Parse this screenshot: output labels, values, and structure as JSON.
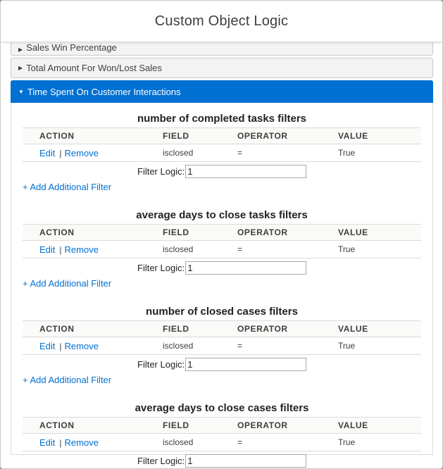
{
  "modal": {
    "title": "Custom Object Logic"
  },
  "sections": [
    {
      "label": "Sales Win Percentage",
      "expanded": false
    },
    {
      "label": "Total Amount For Won/Lost Sales",
      "expanded": false
    },
    {
      "label": "Time Spent On Customer Interactions",
      "expanded": true
    }
  ],
  "columns": [
    "ACTION",
    "FIELD",
    "OPERATOR",
    "VALUE"
  ],
  "actions": {
    "edit": "Edit",
    "separator": "|",
    "remove": "Remove"
  },
  "filter_logic_label": "Filter Logic:",
  "add_filter_label": "+ Add Additional Filter",
  "filters": [
    {
      "title": "number of completed tasks filters",
      "rows": [
        {
          "field": "isclosed",
          "operator": "=",
          "value": "True"
        }
      ],
      "logic": "1"
    },
    {
      "title": "average days to close tasks filters",
      "rows": [
        {
          "field": "isclosed",
          "operator": "=",
          "value": "True"
        }
      ],
      "logic": "1"
    },
    {
      "title": "number of closed cases filters",
      "rows": [
        {
          "field": "isclosed",
          "operator": "=",
          "value": "True"
        }
      ],
      "logic": "1"
    },
    {
      "title": "average days to close cases filters",
      "rows": [
        {
          "field": "isclosed",
          "operator": "=",
          "value": "True"
        }
      ],
      "logic": "1"
    }
  ],
  "colors": {
    "accent": "#0070d2"
  }
}
